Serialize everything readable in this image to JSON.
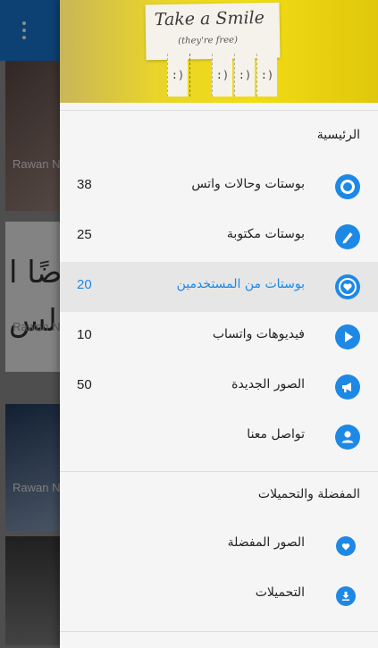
{
  "background": {
    "card_author": "Rawan N",
    "card_text_lines": [
      "ضًا ا",
      "قَالس"
    ]
  },
  "header": {
    "image_title": "Take a Smile",
    "image_subtitle": "(they're free)",
    "tab_glyph": ":)"
  },
  "sections": {
    "main_title": "الرئيسية",
    "favorites_title": "المفضلة والتحميلات"
  },
  "main_items": [
    {
      "label": "بوستات وحالات واتس",
      "count": "38",
      "icon": "status-icon"
    },
    {
      "label": "بوستات مكتوبة",
      "count": "25",
      "icon": "pencil-icon"
    },
    {
      "label": "بوستات من المستخدمين",
      "count": "20",
      "icon": "heart-chat-icon"
    },
    {
      "label": "فيديوهات واتساب",
      "count": "10",
      "icon": "play-icon"
    },
    {
      "label": "الصور الجديدة",
      "count": "50",
      "icon": "megaphone-icon"
    },
    {
      "label": "تواصل معنا",
      "count": "",
      "icon": "person-icon"
    }
  ],
  "favorite_items": [
    {
      "label": "الصور المفضلة",
      "icon": "heart-icon"
    },
    {
      "label": "التحميلات",
      "icon": "download-icon"
    }
  ],
  "colors": {
    "accent": "#1e88e5",
    "appbar": "#1976d2",
    "drawer_bg": "#f5f5f5",
    "active_row": "#e6e6e6"
  }
}
